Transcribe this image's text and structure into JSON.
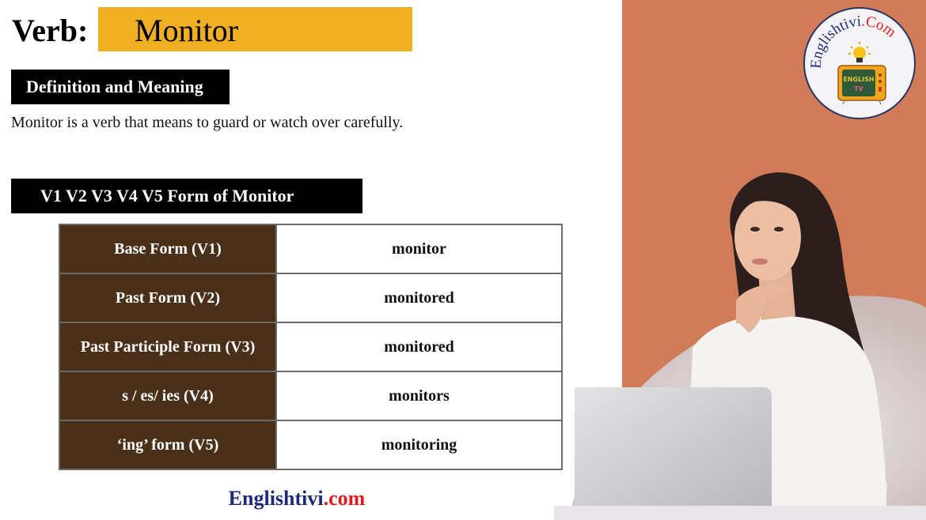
{
  "header": {
    "verb_label": "Verb:",
    "verb": "Monitor"
  },
  "definition": {
    "heading": "Definition and Meaning",
    "text": "Monitor is a verb that means to guard or watch over carefully."
  },
  "forms": {
    "heading": "V1 V2 V3 V4 V5 Form of Monitor",
    "rows": [
      {
        "label": "Base Form (V1)",
        "value": "monitor"
      },
      {
        "label": "Past Form (V2)",
        "value": "monitored"
      },
      {
        "label": "Past Participle Form (V3)",
        "value": "monitored"
      },
      {
        "label": "s / es/ ies (V4)",
        "value": "monitors"
      },
      {
        "label": "‘ing’ form (V5)",
        "value": "monitoring"
      }
    ]
  },
  "footer": {
    "brand_main": "Englishtivi",
    "brand_tld": ".com"
  },
  "logo": {
    "text_main": "Englishtivi",
    "text_tld": ".Com",
    "tv_caption_1": "ENGLISH",
    "tv_caption_2": "TV"
  },
  "colors": {
    "verb_highlight": "#f0af22",
    "table_label_bg": "#4a3018",
    "right_panel_bg": "#d07c58",
    "brand_blue": "#1d2a78",
    "brand_red": "#e01c1c"
  },
  "illustration": {
    "subject": "woman-thinking-with-laptop"
  }
}
